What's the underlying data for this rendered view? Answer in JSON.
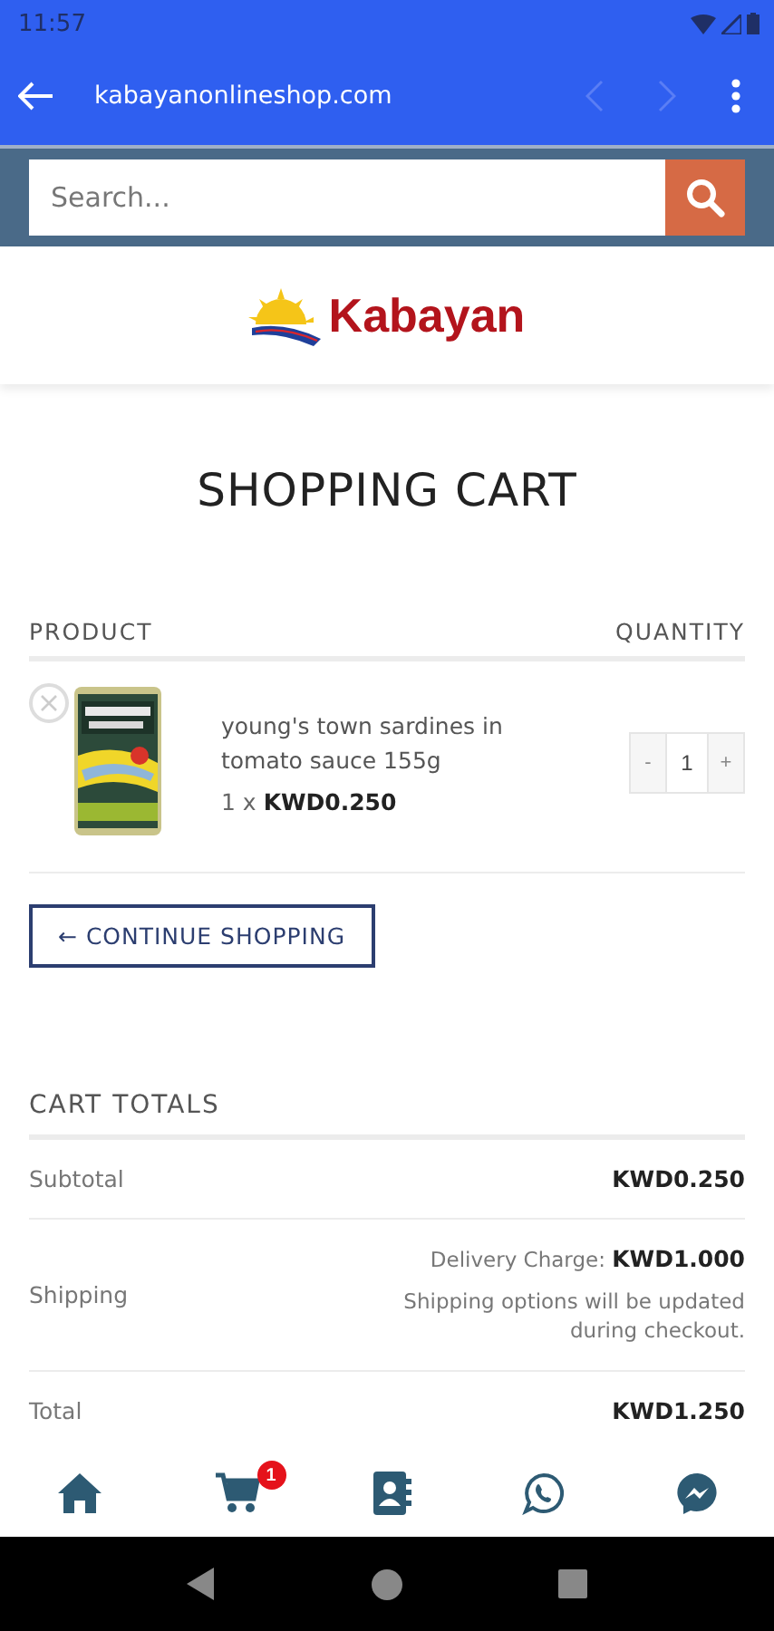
{
  "status_bar": {
    "time": "11:57"
  },
  "browser_bar": {
    "url": "kabayanonlineshop.com"
  },
  "search": {
    "placeholder": "Search..."
  },
  "logo": {
    "text": "Kabayan"
  },
  "page_title": "SHOPPING CART",
  "cart_table": {
    "columns": [
      "PRODUCT",
      "QUANTITY"
    ],
    "items": [
      {
        "name": "young's town sardines in tomato sauce 155g",
        "price_line": "1 x **KWD0.250**",
        "quantity": "1",
        "decrement": "-",
        "increment": "+"
      }
    ]
  },
  "continue_button": "← CONTINUE SHOPPING",
  "cart_totals": {
    "title": "CART TOTALS",
    "rows": [
      {
        "kind": "amount",
        "label": "Subtotal",
        "value": "KWD0.250"
      },
      {
        "kind": "shipping",
        "label": "Shipping",
        "charge_label": "Delivery Charge:",
        "value": "KWD1.000",
        "note": "Shipping options will be updated during checkout."
      },
      {
        "kind": "amount",
        "label": "Total",
        "value": "KWD1.250"
      }
    ]
  },
  "bottom_nav": [
    {
      "kind": "home"
    },
    {
      "kind": "cart",
      "badge": "1"
    },
    {
      "kind": "contacts"
    },
    {
      "kind": "whatsapp"
    },
    {
      "kind": "messenger"
    }
  ]
}
